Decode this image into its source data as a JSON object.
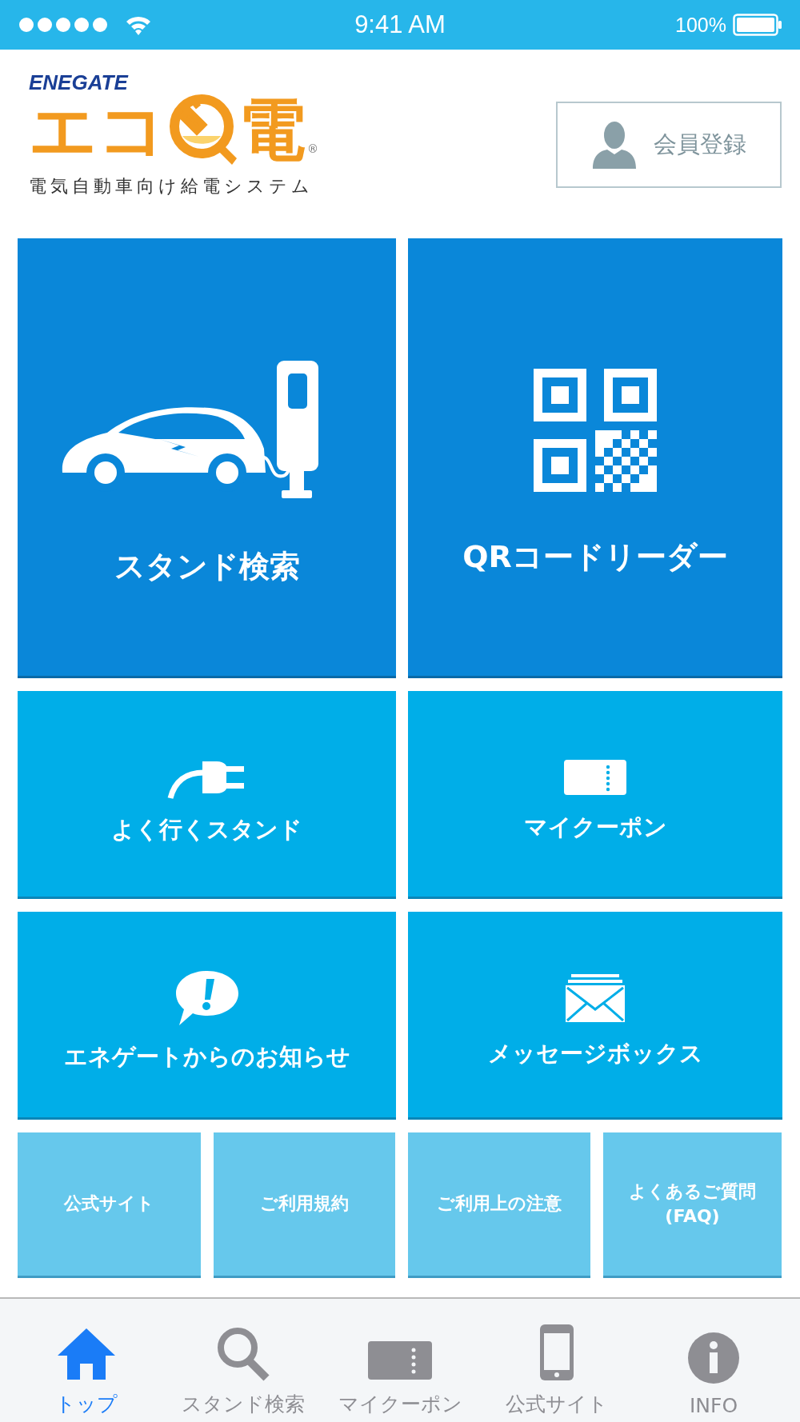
{
  "status_bar": {
    "time": "9:41 AM",
    "battery": "100%"
  },
  "header": {
    "brand": "ENEGATE",
    "logo_left": "エコ",
    "logo_right": "電",
    "registered": "®",
    "tagline": "電気自動車向け給電システム",
    "member_button": "会員登録"
  },
  "tiles": [
    {
      "label": "スタンド検索"
    },
    {
      "label": "QRコードリーダー"
    },
    {
      "label": "よく行くスタンド"
    },
    {
      "label": "マイクーポン"
    },
    {
      "label": "エネゲートからのお知らせ"
    },
    {
      "label": "メッセージボックス"
    }
  ],
  "links": [
    "公式サイト",
    "ご利用規約",
    "ご利用上の注意",
    "よくあるご質問\n(FAQ)"
  ],
  "tab_bar": [
    {
      "label": "トップ",
      "selected": true
    },
    {
      "label": "スタンド検索",
      "selected": false
    },
    {
      "label": "マイクーポン",
      "selected": false
    },
    {
      "label": "公式サイト",
      "selected": false
    },
    {
      "label": "INFO",
      "selected": false
    }
  ]
}
